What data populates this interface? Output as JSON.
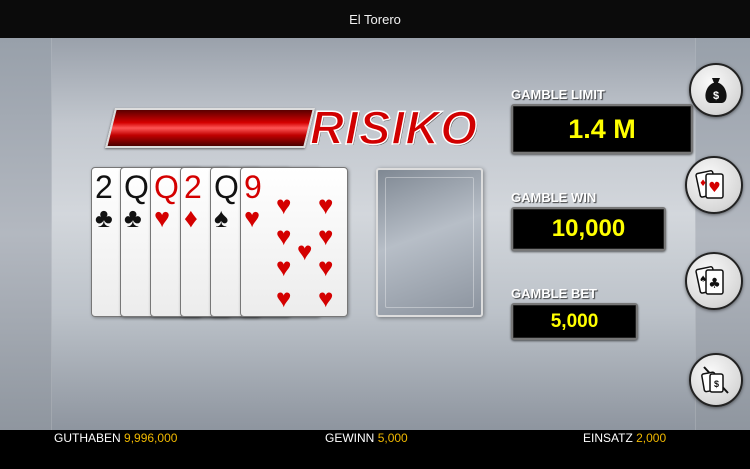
{
  "window": {
    "title": "El Torero"
  },
  "logo": {
    "text": "RISIKO"
  },
  "hand": [
    {
      "rank": "2",
      "suit": "♣",
      "color": "black"
    },
    {
      "rank": "Q",
      "suit": "♣",
      "color": "black"
    },
    {
      "rank": "Q",
      "suit": "♥",
      "color": "red"
    },
    {
      "rank": "2",
      "suit": "♦",
      "color": "red"
    },
    {
      "rank": "Q",
      "suit": "♠",
      "color": "black"
    },
    {
      "rank": "9",
      "suit": "♥",
      "color": "red"
    }
  ],
  "stats": {
    "limit_label": "GAMBLE LIMIT",
    "limit_value": "1.4 M",
    "win_label": "GAMBLE WIN",
    "win_value": "10,000",
    "bet_label": "GAMBLE BET",
    "bet_value": "5,000"
  },
  "side_buttons": [
    {
      "icon": "money-bag-icon"
    },
    {
      "icon": "red-cards-icon"
    },
    {
      "icon": "black-cards-icon"
    },
    {
      "icon": "collect-half-icon"
    }
  ],
  "footer": {
    "balance_label": "GUTHABEN",
    "balance_value": "9,996,000",
    "win_label": "GEWINN",
    "win_value": "5,000",
    "stake_label": "EINSATZ",
    "stake_value": "2,000"
  },
  "colors": {
    "accent": "#d40000",
    "value_yellow": "#ffff00",
    "footer_value": "#f0b800"
  }
}
